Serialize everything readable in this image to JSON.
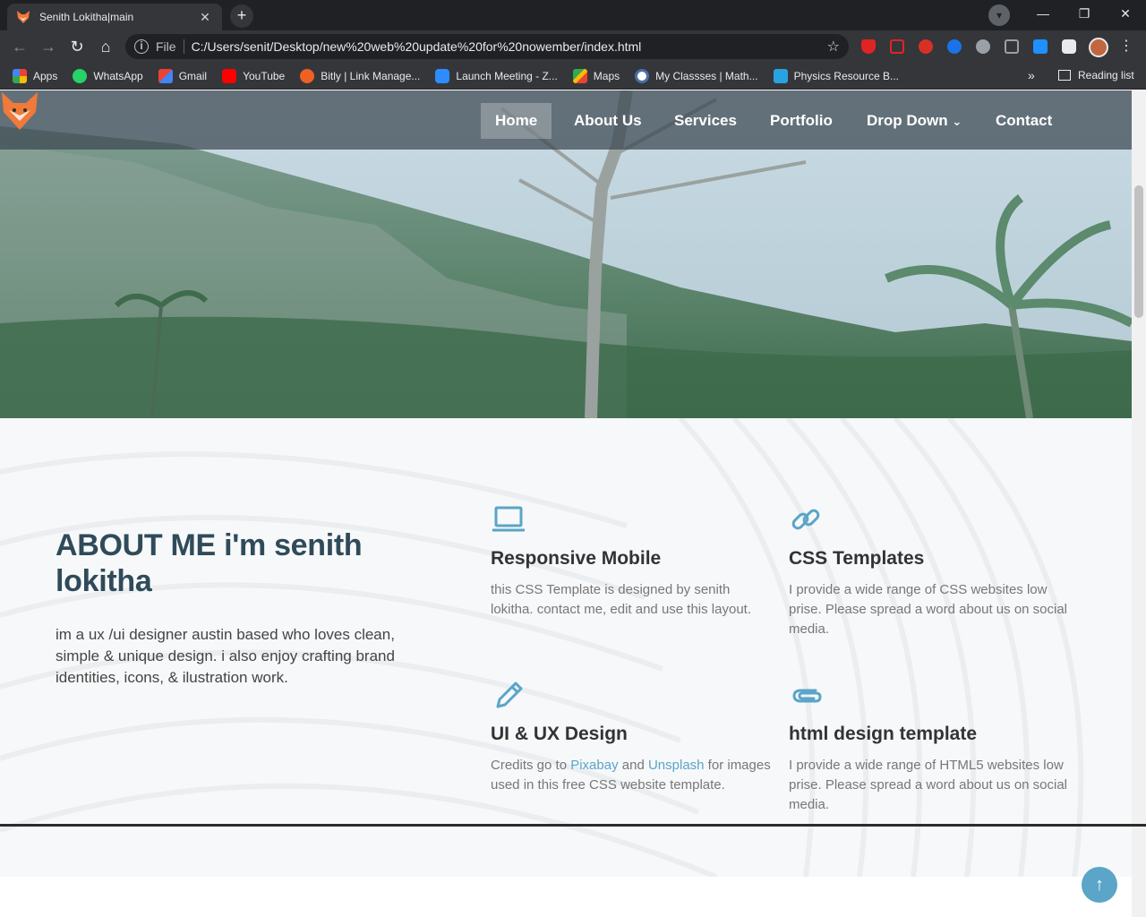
{
  "browser": {
    "tab_title": "Senith Lokitha|main",
    "tab_close": "✕",
    "new_tab": "+",
    "window_controls": {
      "minimize": "—",
      "restore": "❐",
      "close": "✕"
    },
    "nav": {
      "back": "←",
      "forward": "→",
      "reload": "↻",
      "home": "⌂"
    },
    "address": {
      "info": "i",
      "scheme": "File",
      "url": "C:/Users/senit/Desktop/new%20web%20update%20for%20nowember/index.html",
      "star": "☆"
    },
    "bookmarks": [
      {
        "label": "Apps",
        "icon": "apps-grid-icon",
        "color": "#ea4335"
      },
      {
        "label": "WhatsApp",
        "icon": "whatsapp-icon",
        "color": "#25d366"
      },
      {
        "label": "Gmail",
        "icon": "gmail-icon",
        "color": "#ea4335"
      },
      {
        "label": "YouTube",
        "icon": "youtube-icon",
        "color": "#ff0000"
      },
      {
        "label": "Bitly | Link Manage...",
        "icon": "bitly-icon",
        "color": "#ee6123"
      },
      {
        "label": "Launch Meeting - Z...",
        "icon": "zoom-icon",
        "color": "#2d8cff"
      },
      {
        "label": "Maps",
        "icon": "maps-icon",
        "color": "#34a853"
      },
      {
        "label": "My Classses | Math...",
        "icon": "classes-icon",
        "color": "#4a6fa5"
      },
      {
        "label": "Physics Resource B...",
        "icon": "physics-icon",
        "color": "#29a3e0"
      }
    ],
    "bookmarks_more": "»",
    "reading_list": "Reading list",
    "menu": "⋮"
  },
  "site": {
    "nav_items": [
      "Home",
      "About Us",
      "Services",
      "Portfolio",
      "Drop Down",
      "Contact"
    ],
    "dropdown_caret": "⌄",
    "accent_color": "#5aa5c8",
    "about": {
      "heading": "ABOUT ME i'm senith lokitha",
      "intro": "im a ux /ui designer austin based who loves clean, simple & unique design. i also enjoy crafting brand identities, icons, & ilustration work."
    },
    "features": [
      {
        "icon": "laptop-icon",
        "title": "Responsive Mobile",
        "text": "this CSS Template is designed by senith lokitha. contact me, edit and use this layout."
      },
      {
        "icon": "link-icon",
        "title": "CSS Templates",
        "text": "I provide a wide range of CSS websites low prise. Please spread a word about us on social media."
      },
      {
        "icon": "pencil-icon",
        "title": "UI & UX Design",
        "text_before": "Credits go to ",
        "link1": "Pixabay",
        "text_mid": " and ",
        "link2": "Unsplash",
        "text_after": " for images used in this free CSS website template."
      },
      {
        "icon": "paperclip-icon",
        "title": "html design template",
        "text": "I provide a wide range of HTML5 websites low prise. Please spread a word about us on social media."
      }
    ],
    "back_to_top": "↑"
  }
}
